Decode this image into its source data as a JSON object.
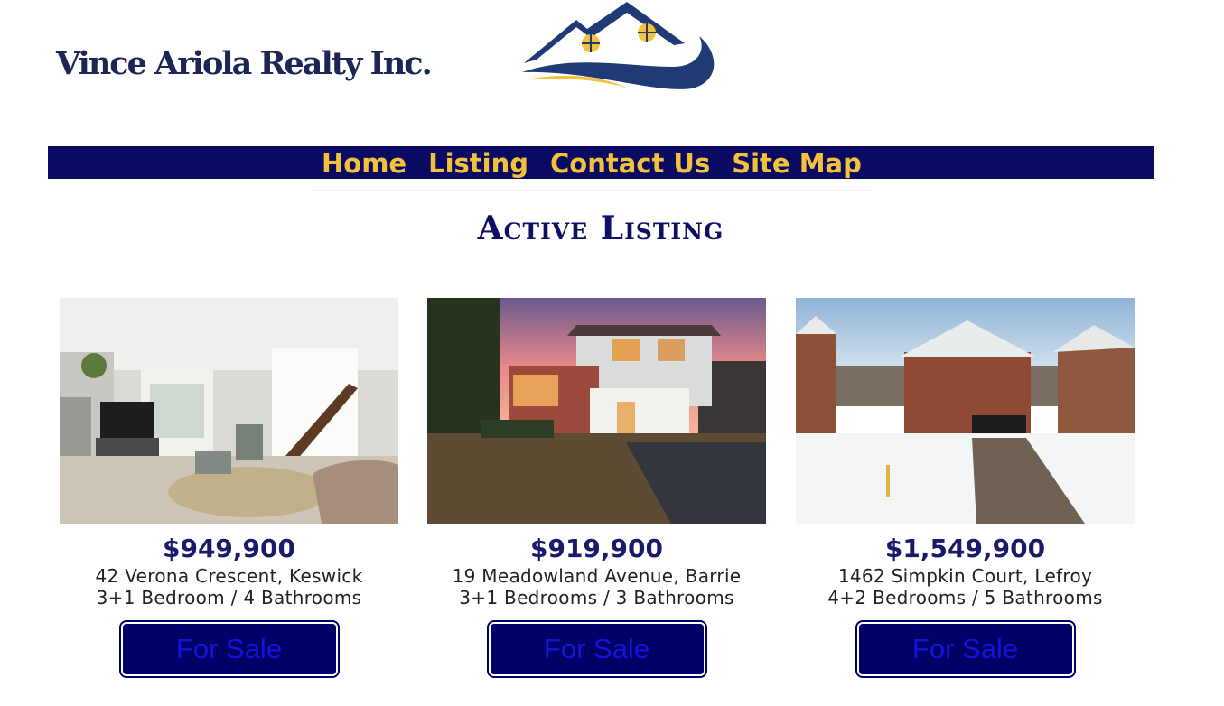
{
  "brand": {
    "name": "Vince Ariola Realty Inc.",
    "colors": {
      "navy": "#1b2655",
      "gold": "#f4c23a",
      "nav_bg": "#0a0a62"
    }
  },
  "nav": {
    "items": [
      {
        "label": "Home"
      },
      {
        "label": "Listing"
      },
      {
        "label": "Contact Us"
      },
      {
        "label": "Site Map"
      }
    ]
  },
  "page": {
    "title": "Active Listing"
  },
  "listings": [
    {
      "price": "$949,900",
      "address": "42 Verona Crescent, Keswick",
      "rooms": "3+1 Bedroom / 4 Bathrooms",
      "button": "For Sale",
      "photo": "living-room-photo"
    },
    {
      "price": "$919,900",
      "address": "19 Meadowland Avenue, Barrie",
      "rooms": "3+1 Bedrooms / 3 Bathrooms",
      "button": "For Sale",
      "photo": "house-exterior-sunset-photo"
    },
    {
      "price": "$1,549,900",
      "address": "1462 Simpkin Court, Lefroy",
      "rooms": "4+2 Bedrooms / 5 Bathrooms",
      "button": "For Sale",
      "photo": "house-exterior-winter-photo"
    }
  ]
}
